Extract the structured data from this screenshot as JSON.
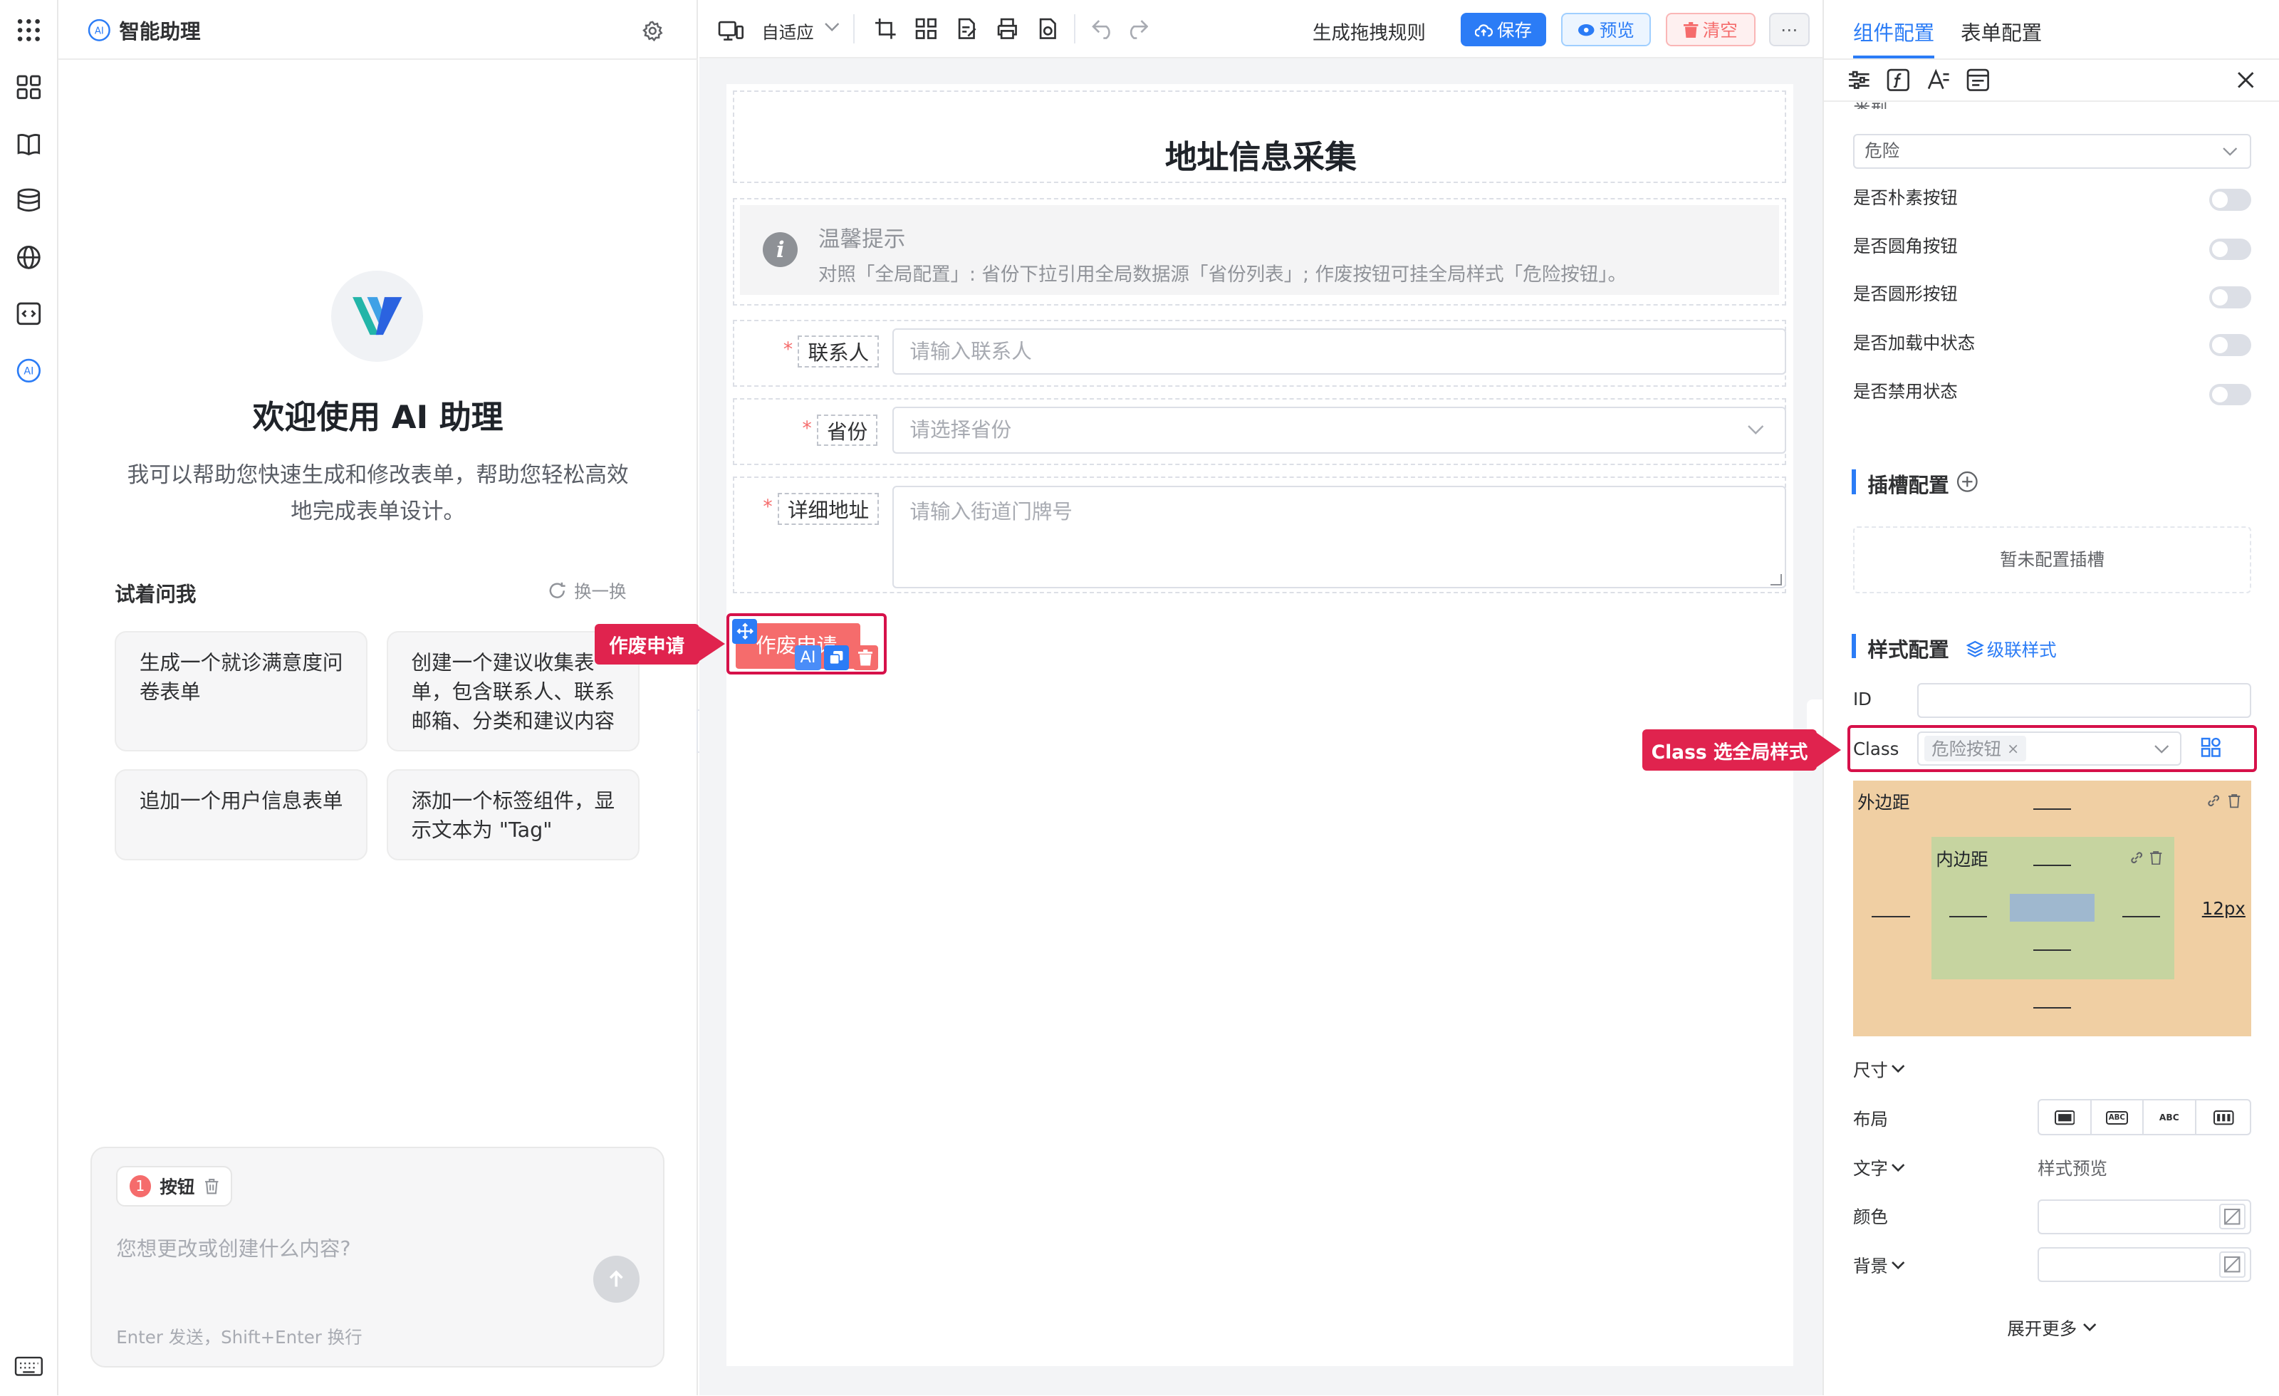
{
  "ai_panel": {
    "title": "智能助理",
    "welcome_title": "欢迎使用 AI 助理",
    "welcome_desc_1": "我可以帮助您快速生成和修改表单，帮助您轻松高效",
    "welcome_desc_2": "地完成表单设计。",
    "try_title": "试着问我",
    "refresh_label": "换一换",
    "suggestions": [
      "生成一个就诊满意度问卷表单",
      "创建一个建议收集表单，包含联系人、联系邮箱、分类和建议内容",
      "追加一个用户信息表单",
      "添加一个标签组件，显示文本为 \"Tag\""
    ],
    "chip_count": "1",
    "chip_label": "按钮",
    "input_placeholder": "您想更改或创建什么内容?",
    "input_hint": "Enter 发送，Shift+Enter 换行"
  },
  "toolbar": {
    "adapt_label": "自适应",
    "gen_rules": "生成拖拽规则",
    "save": "保存",
    "preview": "预览",
    "clear": "清空"
  },
  "form": {
    "title": "地址信息采集",
    "alert_title": "温馨提示",
    "alert_desc": "对照「全局配置」: 省份下拉引用全局数据源「省份列表」; 作废按钮可挂全局样式「危险按钮」。",
    "fields": [
      {
        "label": "联系人",
        "placeholder": "请输入联系人"
      },
      {
        "label": "省份",
        "placeholder": "请选择省份"
      },
      {
        "label": "详细地址",
        "placeholder": "请输入街道门牌号"
      }
    ],
    "button_label": "作废申请",
    "ai_tag": "AI"
  },
  "callouts": {
    "button": "作废申请",
    "class": "Class 选全局样式"
  },
  "right_panel": {
    "tabs": [
      "组件配置",
      "表单配置"
    ],
    "type_label": "类型",
    "type_value": "危险",
    "toggles": [
      "是否朴素按钮",
      "是否圆角按钮",
      "是否圆形按钮",
      "是否加载中状态",
      "是否禁用状态"
    ],
    "slot_title": "插槽配置",
    "slot_empty": "暂未配置插槽",
    "style_title": "样式配置",
    "cascade_link": "级联样式",
    "id_label": "ID",
    "class_label": "Class",
    "class_tag": "危险按钮",
    "margin_label": "外边距",
    "padding_label": "内边距",
    "margin_right_value": "12px",
    "size_label": "尺寸",
    "layout_label": "布局",
    "layout_options": [
      "ABC",
      "ABC"
    ],
    "text_label": "文字",
    "style_preview": "样式预览",
    "color_label": "颜色",
    "bg_label": "背景",
    "expand_more": "展开更多"
  },
  "colors": {
    "primary": "#2b7cf6",
    "danger": "#f56c6c",
    "callout": "#e0234e",
    "margin_box": "#f0cfa3",
    "padding_box": "#c6d4a0",
    "content_box": "#9fb8cf"
  }
}
